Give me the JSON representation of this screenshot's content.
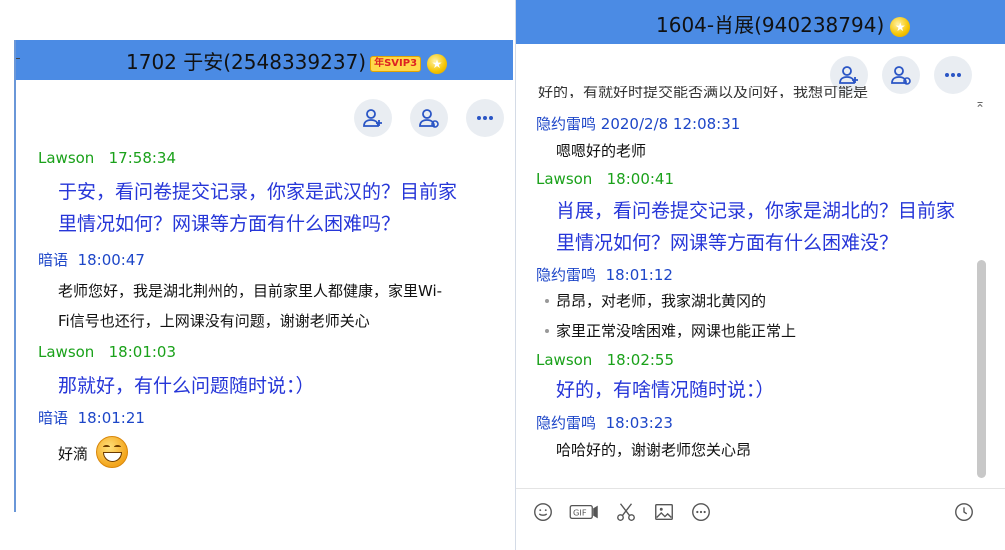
{
  "left_window": {
    "title": "1702 于安(2548339237)",
    "vip_badge": "年SVIP3",
    "messages": [
      {
        "sender": "Lawson",
        "time": "17:58:34",
        "role": "teacher",
        "lines": [
          "于安，看问卷提交记录，你家是武汉的？目前家",
          "里情况如何？网课等方面有什么困难吗？"
        ]
      },
      {
        "sender": "暗语",
        "time": "18:00:47",
        "role": "student",
        "lines": [
          "老师您好，我是湖北荆州的，目前家里人都健康，家里Wi-",
          "Fi信号也还行，上网课没有问题，谢谢老师关心"
        ]
      },
      {
        "sender": "Lawson",
        "time": "18:01:03",
        "role": "teacher",
        "lines": [
          "那就好，有什么问题随时说：）"
        ]
      },
      {
        "sender": "暗语",
        "time": "18:01:21",
        "role": "student",
        "lines": [
          "好滴"
        ]
      }
    ]
  },
  "right_window": {
    "title": "1604-肖展(940238794)",
    "cut_line": "好的，有就好时提交能否满以及问好，我想可能是",
    "messages": [
      {
        "sender": "隐约雷鸣",
        "time": "2020/2/8 12:08:31",
        "role": "student",
        "lines": [
          "嗯嗯好的老师"
        ]
      },
      {
        "sender": "Lawson",
        "time": "18:00:41",
        "role": "teacher",
        "lines": [
          "肖展，看问卷提交记录，你家是湖北的？目前家",
          "里情况如何？网课等方面有什么困难没？"
        ]
      },
      {
        "sender": "隐约雷鸣",
        "time": "18:01:12",
        "role": "student",
        "lines": [
          "昂昂，对老师，我家湖北黄冈的",
          "家里正常没啥困难，网课也能正常上"
        ]
      },
      {
        "sender": "Lawson",
        "time": "18:02:55",
        "role": "teacher",
        "lines": [
          "好的，有啥情况随时说：）"
        ]
      },
      {
        "sender": "隐约雷鸣",
        "time": "18:03:23",
        "role": "student",
        "lines": [
          "哈哈好的，谢谢老师您关心昂"
        ]
      }
    ],
    "toolbar_icons": [
      "emoji-icon",
      "gif-icon",
      "scissors-icon",
      "image-icon",
      "more-icon",
      "clock-icon"
    ]
  },
  "action_icons": [
    "add-member-icon",
    "manage-member-icon",
    "more-options-icon"
  ],
  "colors": {
    "titlebar": "#4b8be4",
    "teacher_name": "#1aa11a",
    "student_name": "#1d46c8",
    "teacher_text": "#2636d8"
  }
}
